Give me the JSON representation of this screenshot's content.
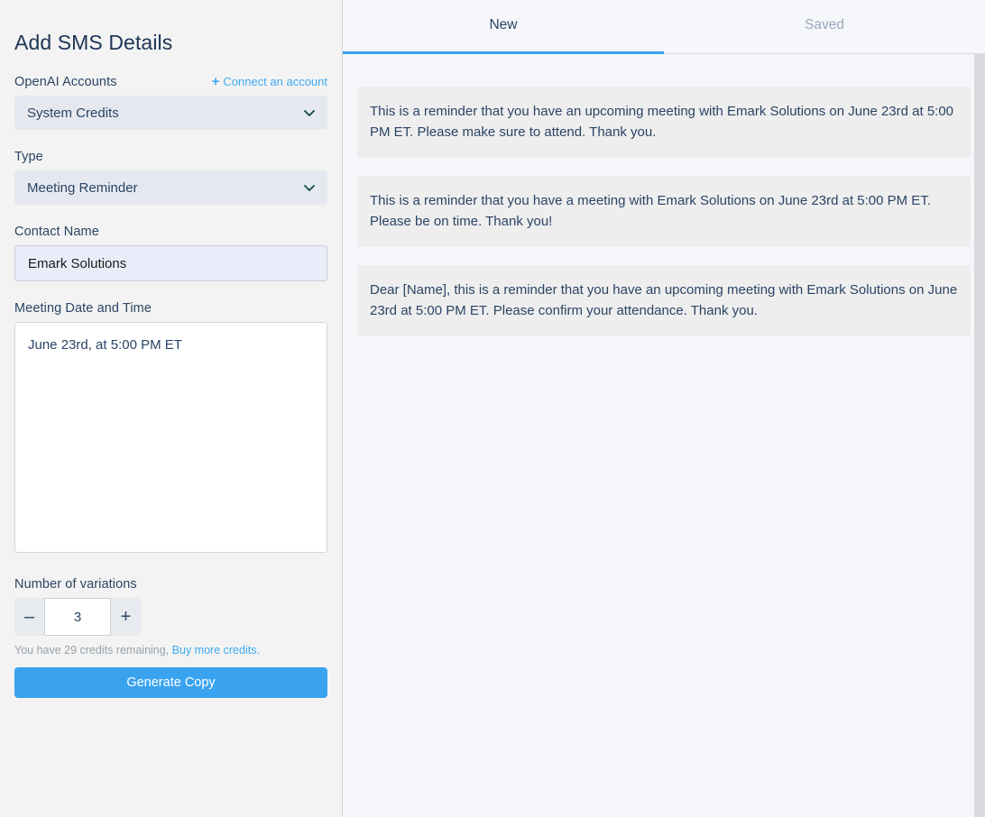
{
  "sidebar": {
    "title": "Add SMS Details",
    "accounts": {
      "label": "OpenAI Accounts",
      "connect_label": "Connect an account",
      "plus_icon": "plus-icon",
      "selected": "System Credits"
    },
    "type": {
      "label": "Type",
      "selected": "Meeting Reminder"
    },
    "contact_name": {
      "label": "Contact Name",
      "value": "Emark Solutions",
      "placeholder": "Contact Name"
    },
    "meeting_datetime": {
      "label": "Meeting Date and Time",
      "value": "June 23rd, at 5:00 PM ET",
      "placeholder": "Meeting Date and Time"
    },
    "variations": {
      "label": "Number of variations",
      "value": "3",
      "decrement_label": "–",
      "increment_label": "+"
    },
    "credits": {
      "text": "You have 29 credits remaining,",
      "link": "Buy more credits."
    },
    "generate_label": "Generate Copy"
  },
  "main": {
    "tabs": [
      {
        "label": "New",
        "active": true
      },
      {
        "label": "Saved",
        "active": false
      }
    ],
    "results": [
      "This is a reminder that you have an upcoming meeting with Emark Solutions on June 23rd at 5:00 PM ET. Please make sure to attend. Thank you.",
      "This is a reminder that you have a meeting with Emark Solutions on June 23rd at 5:00 PM ET. Please be on time. Thank you!",
      "Dear [Name], this is a reminder that you have an upcoming meeting with Emark Solutions on June 23rd at 5:00 PM ET. Please confirm your attendance. Thank you."
    ]
  },
  "colors": {
    "accent_blue": "#3aa3ef",
    "link_blue": "#3fa9f5",
    "text_navy": "#2b4465",
    "card_bg": "#eeeeee",
    "chevron": "#0f4b46"
  }
}
